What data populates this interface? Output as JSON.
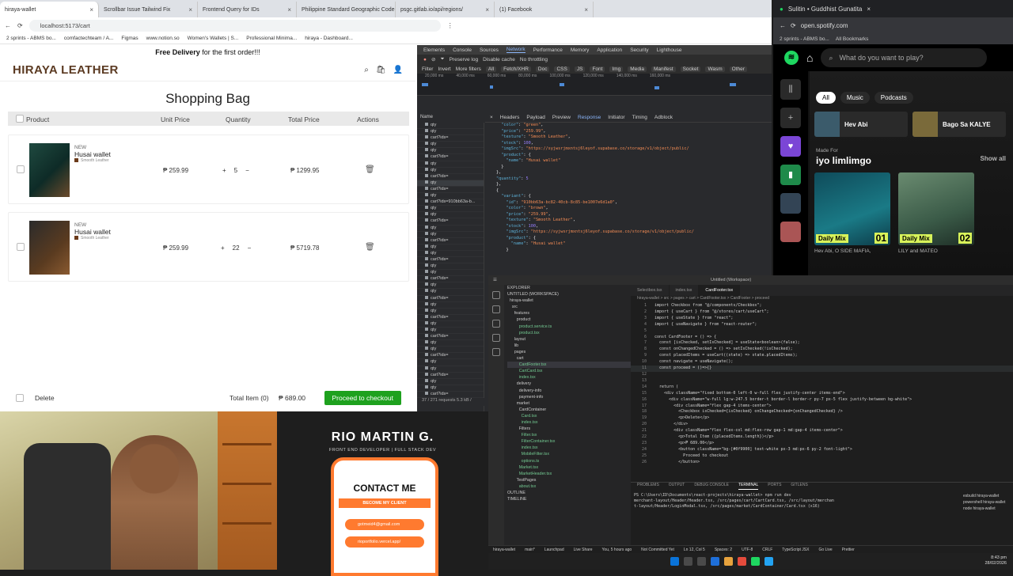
{
  "browser": {
    "tabs": [
      "hiraya-wallet",
      "Scrollbar Issue Tailwind Fix",
      "Frontend Query for IDs",
      "Philippine Standard Geographic Code",
      "psgc.gitlab.io/api/regions/",
      "(1) Facebook"
    ],
    "url": "localhost:5173/cart",
    "bookmarks": [
      "2 sprints - ABMS bo...",
      "comfactechteam / A...",
      "Figmas",
      "www.notion.so",
      "Women's Wallets | S...",
      "Professional Minima...",
      "hiraya - Dashboard...",
      "All Bookmarks"
    ]
  },
  "shop": {
    "promo_bold": "Free Delivery",
    "promo_rest": " for the first order!!!",
    "brand": "HIRAYA LEATHER",
    "title": "Shopping Bag",
    "columns": {
      "product": "Product",
      "unit_price": "Unit Price",
      "quantity": "Quantity",
      "total_price": "Total Price",
      "actions": "Actions"
    },
    "items": [
      {
        "badge": "NEW",
        "name": "Husai wallet",
        "texture": "Smooth Leather",
        "unit_price": "₱ 259.99",
        "quantity": "5",
        "total": "₱ 1299.95"
      },
      {
        "badge": "NEW",
        "name": "Husai wallet",
        "texture": "Smooth Leather",
        "unit_price": "₱ 259.99",
        "quantity": "22",
        "total": "₱ 5719.78"
      }
    ],
    "footer": {
      "delete": "Delete",
      "total_items": "Total Item (0)",
      "total_price": "₱ 689.00",
      "checkout": "Proceed to checkout"
    }
  },
  "devtools": {
    "tabs": [
      "Elements",
      "Console",
      "Sources",
      "Network",
      "Performance",
      "Memory",
      "Application",
      "Security",
      "Lighthouse"
    ],
    "active_tab": "Network",
    "toolbar": [
      "Preserve log",
      "Disable cache",
      "No throttling"
    ],
    "filter": [
      "Filter",
      "Invert",
      "More filters",
      "All",
      "Fetch/XHR",
      "Doc",
      "CSS",
      "JS",
      "Font",
      "Img",
      "Media",
      "Manifest",
      "Socket",
      "Wasm",
      "Other"
    ],
    "timeline_labels": [
      "20,000 ms",
      "40,000 ms",
      "60,000 ms",
      "80,000 ms",
      "100,000 ms",
      "120,000 ms",
      "140,000 ms",
      "160,000 ms"
    ],
    "list_header": "Name",
    "requests": [
      "qty",
      "qty",
      "cart?ids=",
      "qty",
      "qty",
      "cart?ids=",
      "qty",
      "qty",
      "cart?ids=",
      "qty",
      "cart?ids=",
      "qty",
      "cart?ids=910bb63a-b...",
      "qty",
      "qty",
      "cart?ids=",
      "qty",
      "qty",
      "cart?ids=",
      "qty",
      "qty",
      "cart?ids=",
      "qty",
      "qty",
      "cart?ids=",
      "qty",
      "qty",
      "cart?ids=",
      "qty",
      "qty",
      "cart?ids=",
      "qty",
      "qty",
      "cart?ids=",
      "qty",
      "qty",
      "cart?ids=",
      "qty",
      "qty",
      "cart?ids=",
      "qty",
      "qty",
      "cart?ids=",
      "qty"
    ],
    "detail_tabs": [
      "Headers",
      "Payload",
      "Preview",
      "Response",
      "Initiator",
      "Timing",
      "Adblock"
    ],
    "active_detail": "Response",
    "status": "37 / 271 requests   5.3 kB /"
  },
  "spotify": {
    "tab_title": "Sulitin • Guddhist Gunatita",
    "url": "open.spotify.com",
    "bookmarks": [
      "2 sprints - ABMS bo...",
      "All Bookmarks"
    ],
    "search_placeholder": "What do you want to play?",
    "pills": [
      "All",
      "Music",
      "Podcasts"
    ],
    "tiles": [
      "Hev Abi",
      "Bago Sa KALYE"
    ],
    "made_for": "Made For",
    "user": "iyo limlimgo",
    "show_all": "Show all",
    "mixes": [
      {
        "label": "Daily Mix",
        "num": "01",
        "caption": "Hev Abi, O SIDE MAFIA,"
      },
      {
        "label": "Daily Mix",
        "num": "02",
        "caption": "LILY and MATEO"
      }
    ]
  },
  "card": {
    "name": "RIO MARTIN G.",
    "subtitle": "FRONT END DEVELOPER | FULL STACK DEV",
    "contact": "CONTACT ME",
    "become": "BECOME MY CLIENT",
    "links": [
      "gotmeid4@gmail.com",
      "rioportfolio.vercel.app/"
    ]
  },
  "vscode": {
    "title": "Untitled (Workspace)",
    "tabs": [
      "Selectbox.tsx",
      "index.tsx",
      "CardFooter.tsx"
    ],
    "breadcrumb": "hiraya-wallet > src > pages > cart > CardFooter.tsx > CardFooter > proceed",
    "explorer_header": "EXPLORER",
    "explorer": [
      "UNTITLED (WORKSPACE)",
      "  hiraya-wallet",
      "    src",
      "      features",
      "        product",
      "          product.service.ts",
      "          product.tsx",
      "      layout",
      "      lib",
      "      pages",
      "        cart",
      "          CardFooter.tsx",
      "          CartCard.tsx",
      "          index.tsx",
      "        delivery",
      "          delivery-info",
      "          payment-info",
      "        market",
      "          CardContainer",
      "            Card.tsx",
      "            index.tsx",
      "          Filters",
      "            Filter.tsx",
      "            FilterContainer.tsx",
      "            index.tsx",
      "            MobileFilter.tsx",
      "            options.ts",
      "          Market.tsx",
      "          MarketHeader.tsx",
      "        TestPages",
      "          about.tsx",
      "OUTLINE",
      "TIMELINE"
    ],
    "code": [
      "import Checkbox from \"@/components/Checkbox\";",
      "import { useCart } from \"@/stores/cart/useCart\";",
      "import { useState } from \"react\";",
      "import { useNavigate } from \"react-router\";",
      "",
      "const CardFooter = () => {",
      "  const [isChecked, setIsChecked] = useState<boolean>(false);",
      "  const onChangedChecked = () => setIsChecked(!isChecked);",
      "  const placedItems = useCart((state) => state.placedItems);",
      "  const navigate = useNavigate();",
      "  const proceed = ()=>{}",
      "",
      "",
      "  return (",
      "    <div className=\"fixed bottom-0 left-0 w-full flex justify-center items-end\">",
      "      <div className=\"w-full lg:w-247.5 border-t border-l border-r py-7 px-5 flex justify-between bg-white\">",
      "        <div className=\"flex gap-4 items-center\">",
      "          <Checkbox isChecked={isChecked} onChangeChecked={onChangedChecked} />",
      "          <p>Delete</p>",
      "        </div>",
      "        <div className=\"flex flex-col md:flex-row gap-1 md:gap-4 items-center\">",
      "          <p>Total Item ({placedItems.length})</p>",
      "          <p>₱ 689.00</p>",
      "          <button className=\"bg-[#0f9900] text-white px-3 md:px-6 py-2 font-light\">",
      "            Proceed to checkout",
      "          </button>"
    ],
    "terminal_tabs": [
      "PROBLEMS",
      "OUTPUT",
      "DEBUG CONSOLE",
      "TERMINAL",
      "PORTS",
      "GITLENS"
    ],
    "terminal": [
      "PS C:\\Users\\ID\\Documents\\react-projects\\hiraya-wallet> npm run dev",
      "merchant-layout/Header/Header.tsx, /src/pages/cart/CartCard.tsx, /src/layout/merchan",
      "t-layout/Header/LoginModal.tsx, /src/pages/market/CardContainer/Card.tsx (x16)"
    ],
    "side_terminals": [
      "esbuild hiraya-wallet",
      "powershell hiraya-wallet",
      "node hiraya-wallet"
    ],
    "status": [
      "hiraya-wallet",
      "main*",
      "Launchpad",
      "Live Share",
      "You, 5 hours ago",
      "Not Committed Yet",
      "Ln 12, Col 5",
      "Spaces: 2",
      "UTF-8",
      "CRLF",
      "TypeScript JSX",
      "Go Live",
      "Prettier"
    ],
    "clock": "8:43 pm",
    "date": "28/02/2026"
  }
}
